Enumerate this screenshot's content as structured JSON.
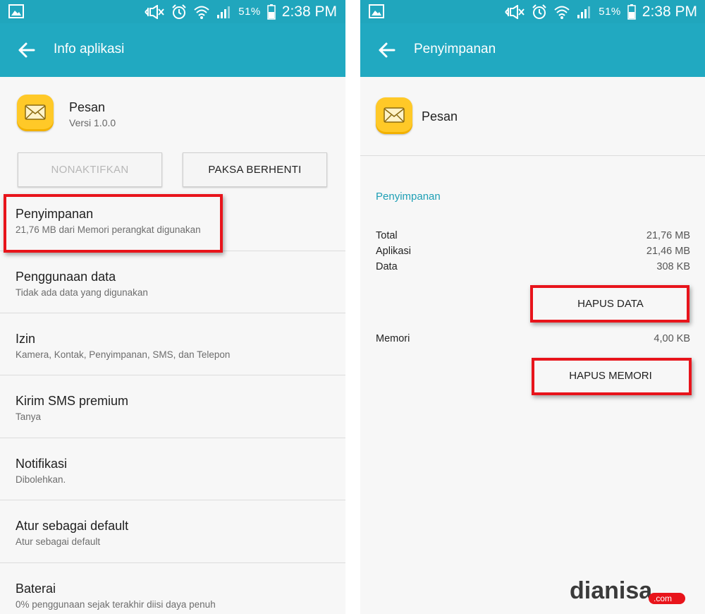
{
  "status_bar": {
    "battery_percent": "51%",
    "time": "2:38 PM"
  },
  "left_screen": {
    "title": "Info aplikasi",
    "app": {
      "name": "Pesan",
      "version": "Versi 1.0.0"
    },
    "buttons": {
      "disable": "NONAKTIFKAN",
      "force_stop": "PAKSA BERHENTI"
    },
    "items": [
      {
        "title": "Penyimpanan",
        "subtitle": "21,76 MB dari Memori perangkat digunakan"
      },
      {
        "title": "Penggunaan data",
        "subtitle": "Tidak ada data yang digunakan"
      },
      {
        "title": "Izin",
        "subtitle": "Kamera, Kontak, Penyimpanan, SMS, dan Telepon"
      },
      {
        "title": "Kirim SMS premium",
        "subtitle": "Tanya"
      },
      {
        "title": "Notifikasi",
        "subtitle": "Dibolehkan."
      },
      {
        "title": "Atur sebagai default",
        "subtitle": "Atur sebagai default"
      },
      {
        "title": "Baterai",
        "subtitle": "0% penggunaan sejak terakhir diisi daya penuh"
      }
    ]
  },
  "right_screen": {
    "title": "Penyimpanan",
    "app": {
      "name": "Pesan"
    },
    "section_header": "Penyimpanan",
    "storage": [
      {
        "label": "Total",
        "value": "21,76 MB"
      },
      {
        "label": "Aplikasi",
        "value": "21,46 MB"
      },
      {
        "label": "Data",
        "value": "308 KB"
      }
    ],
    "clear_data_label": "HAPUS DATA",
    "cache": {
      "label": "Memori",
      "value": "4,00 KB"
    },
    "clear_cache_label": "HAPUS MEMORI"
  },
  "watermark": {
    "main": "dianisa",
    "suffix": ".com"
  },
  "colors": {
    "status_bar": "#20a6bd",
    "app_bar": "#21a9c1",
    "accent_text": "#1e9fb5",
    "highlight": "#e8141b",
    "app_icon": "#ffc928"
  },
  "icons": [
    "gallery-icon",
    "mute-icon",
    "alarm-icon",
    "wifi-icon",
    "signal-icon",
    "battery-icon",
    "back-arrow-icon",
    "envelope-icon"
  ]
}
